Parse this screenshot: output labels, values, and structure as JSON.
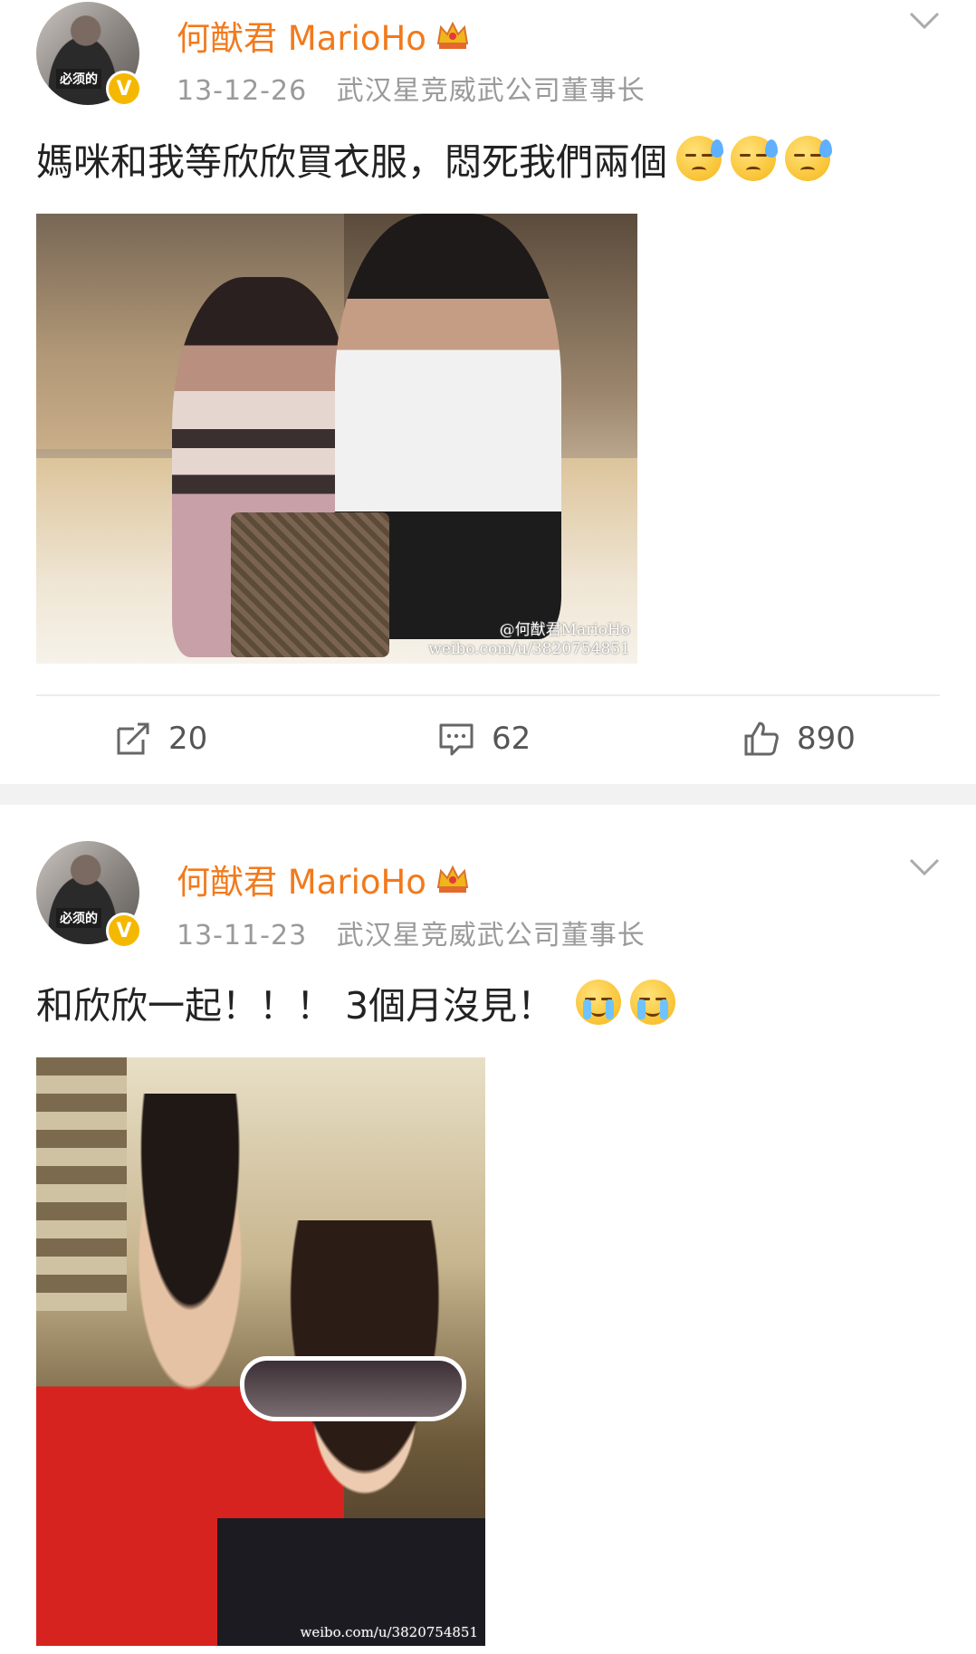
{
  "posts": [
    {
      "user": {
        "name": "何猷君 MarioHo",
        "avatar_stamp": "必须的",
        "verified_badge": "V"
      },
      "meta": {
        "date": "13-12-26",
        "bio": "武汉星竞威武公司董事长"
      },
      "text": "媽咪和我等欣欣買衣服，悶死我們兩個",
      "emojis": [
        "sweat-emoji",
        "sweat-emoji",
        "sweat-emoji"
      ],
      "image": {
        "watermark_line1": "@何猷君MarioHo",
        "watermark_line2": "weibo.com/u/3820754851"
      },
      "actions": {
        "repost": "20",
        "comment": "62",
        "like": "890"
      }
    },
    {
      "user": {
        "name": "何猷君 MarioHo",
        "avatar_stamp": "必须的",
        "verified_badge": "V"
      },
      "meta": {
        "date": "13-11-23",
        "bio": "武汉星竞威武公司董事长"
      },
      "text": "和欣欣一起！！！ 3個月沒見！",
      "emojis": [
        "crying-emoji",
        "crying-emoji"
      ],
      "image": {
        "watermark_line2": "weibo.com/u/3820754851"
      }
    }
  ],
  "colors": {
    "username": "#f27a1c",
    "meta": "#9a9a9a",
    "separator": "#f2f2f2",
    "verified": "#f5b800"
  }
}
